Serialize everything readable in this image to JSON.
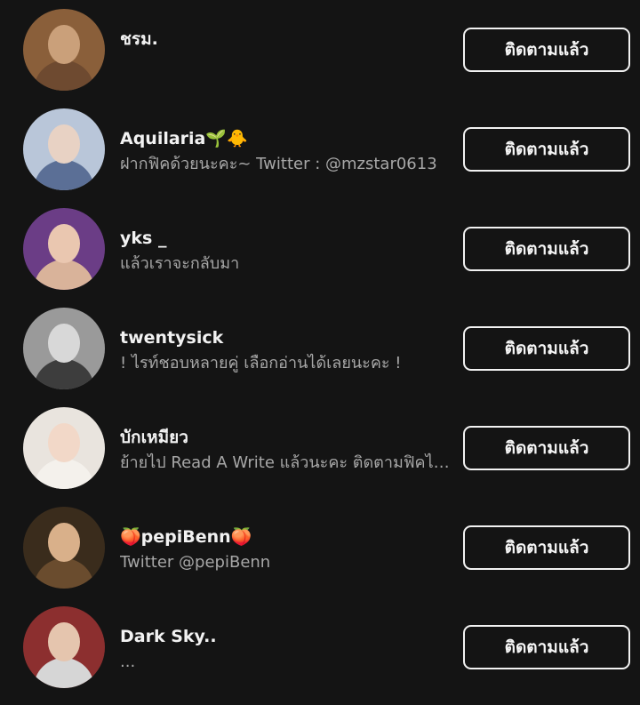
{
  "rows": [
    {
      "name": "ชรม.",
      "bio": "",
      "button": "ติดตามแล้ว",
      "avatar_icon": "user-photo",
      "avatar_bg": "#8a5f3a",
      "avatar_face": "#caa07a",
      "avatar_body": "#6e4a30"
    },
    {
      "name": "Aquilaria🌱🐥",
      "bio": "ฝากฟิคด้วยนะคะ~ Twitter : @mzstar0613",
      "button": "ติดตามแล้ว",
      "avatar_icon": "user-photo",
      "avatar_bg": "#b9c6d9",
      "avatar_face": "#e8d2c4",
      "avatar_body": "#5b6f96"
    },
    {
      "name": "yks _",
      "bio": "แล้วเราจะกลับมา",
      "button": "ติดตามแล้ว",
      "avatar_icon": "user-photo",
      "avatar_bg": "#6b3d86",
      "avatar_face": "#eac7b0",
      "avatar_body": "#d9b39a"
    },
    {
      "name": "twentysick",
      "bio": "! ไรท์ชอบหลายคู่ เลือกอ่านได้เลยนะคะ !",
      "button": "ติดตามแล้ว",
      "avatar_icon": "user-photo",
      "avatar_bg": "#9a9a9a",
      "avatar_face": "#d8d8d8",
      "avatar_body": "#3d3d3d"
    },
    {
      "name": "บักเหมียว",
      "bio": "ย้ายไป Read A Write แล้วนะคะ ติดตามฟิคได้เลย",
      "button": "ติดตามแล้ว",
      "avatar_icon": "user-photo",
      "avatar_bg": "#e9e4de",
      "avatar_face": "#f2d8c8",
      "avatar_body": "#f4f1ec"
    },
    {
      "name": "🍑pepiBenn🍑",
      "bio": "Twitter @pepiBenn",
      "button": "ติดตามแล้ว",
      "avatar_icon": "user-photo",
      "avatar_bg": "#3a2c1c",
      "avatar_face": "#d9b08a",
      "avatar_body": "#6a4c2e"
    },
    {
      "name": "Dark Sky..",
      "bio": "...",
      "button": "ติดตามแล้ว",
      "avatar_icon": "user-photo",
      "avatar_bg": "#8c2f2f",
      "avatar_face": "#e5c5ae",
      "avatar_body": "#d6d6d6"
    }
  ]
}
